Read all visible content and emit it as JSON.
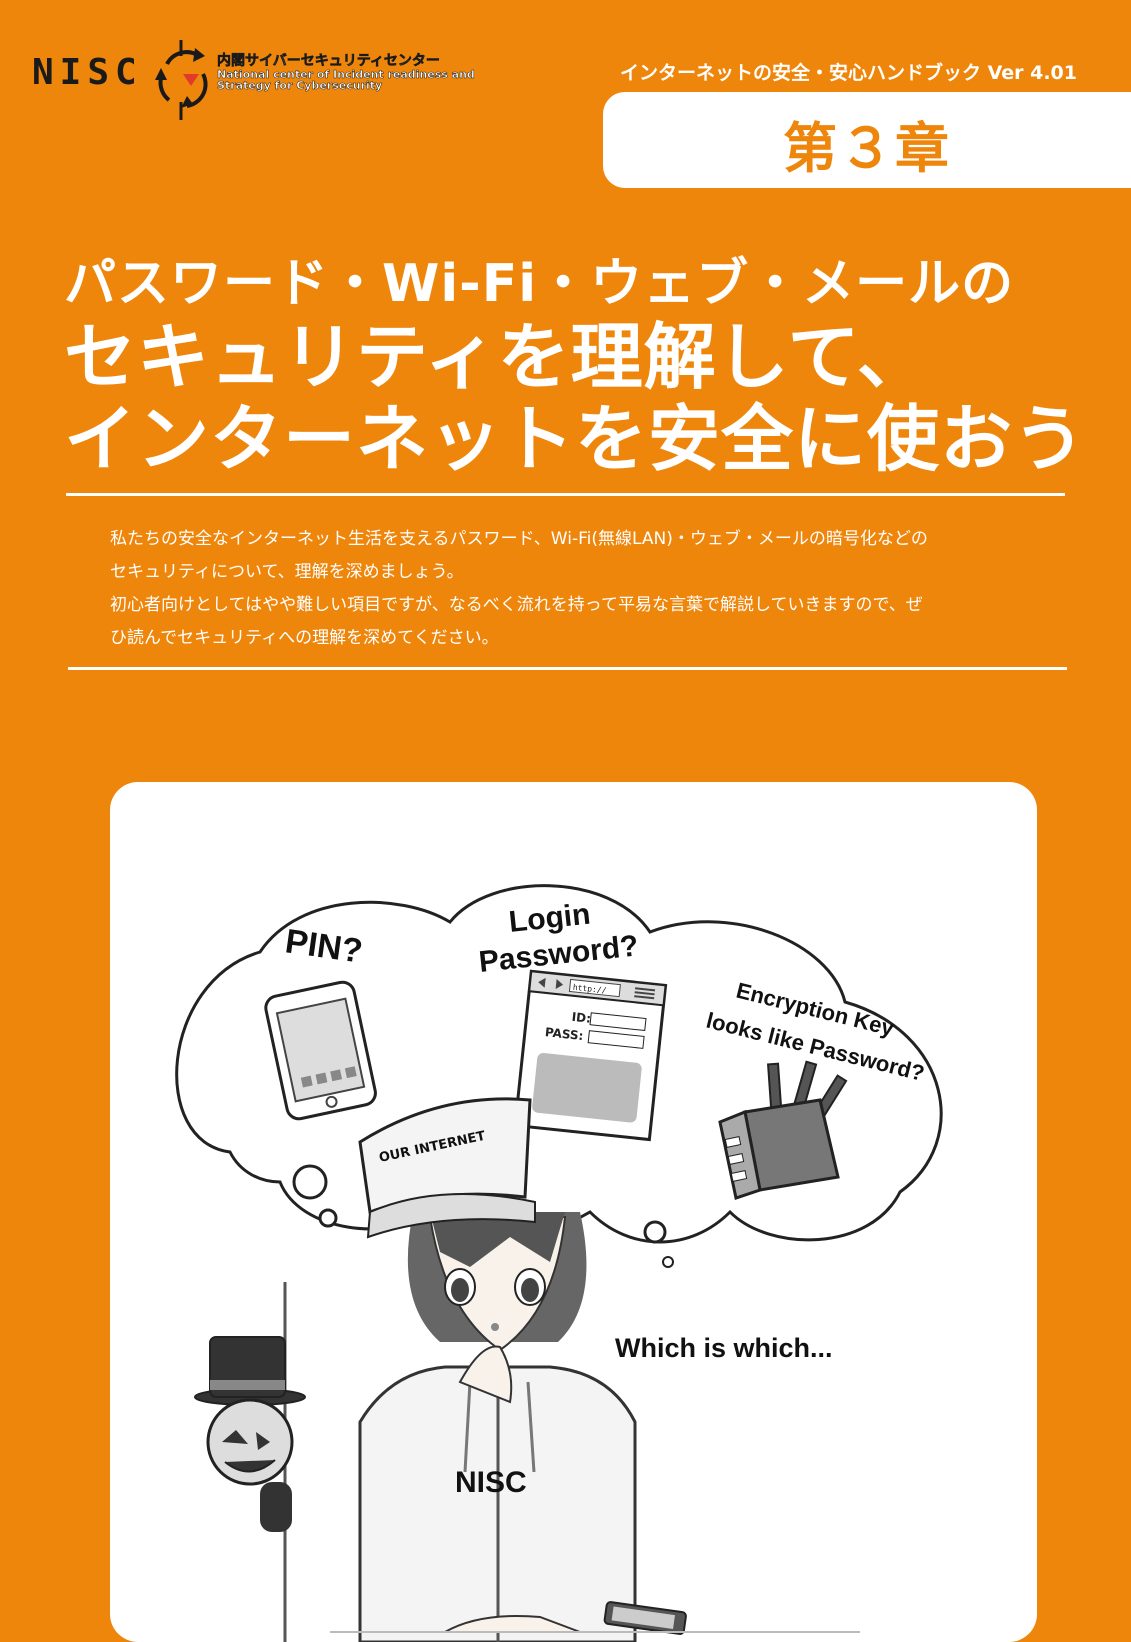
{
  "header": {
    "logo_wordmark": "NISC",
    "org_name_ja": "内閣サイバーセキュリティセンター",
    "org_name_en_1": "National center of Incident readiness and",
    "org_name_en_2": "Strategy for Cybersecurity",
    "handbook_title": "インターネットの安全・安心ハンドブック Ver 4.01",
    "chapter": "第３章"
  },
  "title": {
    "line1": "パスワード・Wi-Fi・ウェブ・メールの",
    "line2": "セキュリティを理解して、",
    "line3": "インターネットを安全に使おう"
  },
  "intro": {
    "p1_line1": "私たちの安全なインターネット生活を支えるパスワード、Wi-Fi(無線LAN)・ウェブ・メールの暗号化などの",
    "p1_line2": "セキュリティについて、理解を深めましょう。",
    "p2_line1": "初心者向けとしてはやや難しい項目ですが、なるべく流れを持って平易な言葉で解説していきますので、ぜ",
    "p2_line2": "ひ読んでセキュリティへの理解を深めてください。"
  },
  "illustration": {
    "bubble_pin": "PIN?",
    "bubble_login_1": "Login",
    "bubble_login_2": "Password?",
    "browser_url": "http://",
    "browser_id_label": "ID:",
    "browser_pass_label": "PASS:",
    "bubble_key_1": "Encryption Key",
    "bubble_key_2": "looks like Password?",
    "hat_text": "OUR INTERNET",
    "hoodie_text": "NISC",
    "caption": "Which is which..."
  },
  "colors": {
    "background": "#ef860c",
    "accent_red": "#e23a2a",
    "panel": "#ffffff"
  }
}
